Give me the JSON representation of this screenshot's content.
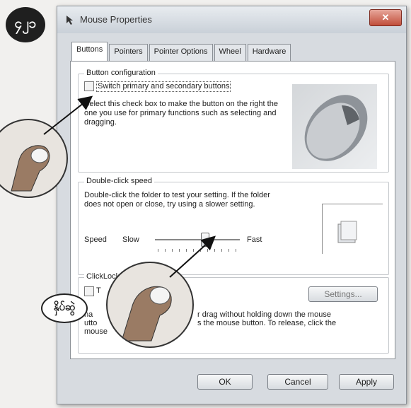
{
  "page_badge": "၄၂၁",
  "side_badge": "နှိပ်ဆွဲ",
  "window": {
    "title": "Mouse Properties",
    "close": "✕"
  },
  "tabs": [
    "Buttons",
    "Pointers",
    "Pointer Options",
    "Wheel",
    "Hardware"
  ],
  "button_config": {
    "title": "Button configuration",
    "checkbox_label": "Switch primary and secondary buttons",
    "desc": "Select this check box to make the button on the right the one you use for primary functions such as selecting and dragging."
  },
  "double_click": {
    "title": "Double-click speed",
    "desc": "Double-click the folder to test your setting. If the folder does not open or close, try using a slower setting.",
    "speed_label": "Speed",
    "slow": "Slow",
    "fast": "Fast",
    "slider_level": 0.58
  },
  "clicklock": {
    "title": "ClickLock",
    "checkbox_label": "T",
    "settings_button": "Settings...",
    "desc_1": "r drag without holding down the mouse",
    "desc_2": "s the mouse button. To release, click the",
    "desc_left_1": "na",
    "desc_left_2": "utto",
    "desc_left_3": "mouse"
  },
  "buttons": {
    "ok": "OK",
    "cancel": "Cancel",
    "apply": "Apply"
  }
}
